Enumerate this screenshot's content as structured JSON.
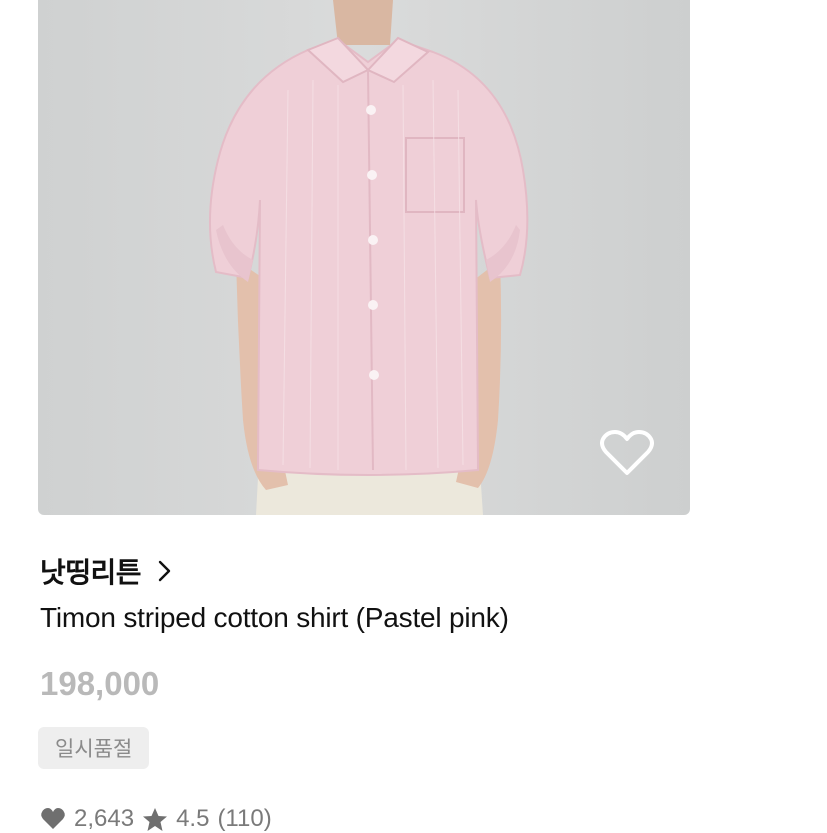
{
  "product": {
    "brand": "낫띵리튼",
    "title": "Timon striped cotton shirt (Pastel pink)",
    "price": "198,000",
    "status_badge": "일시품절",
    "likes": "2,643",
    "rating": "4.5",
    "review_count": "(110)"
  },
  "icons": {
    "wishlist": "heart-outline-icon",
    "brand_link": "chevron-right-icon",
    "likes": "heart-filled-icon",
    "rating": "star-icon"
  },
  "colors": {
    "price": "#b9b9b9",
    "badge_bg": "#eeeeee",
    "stats": "#7a7a7a"
  }
}
